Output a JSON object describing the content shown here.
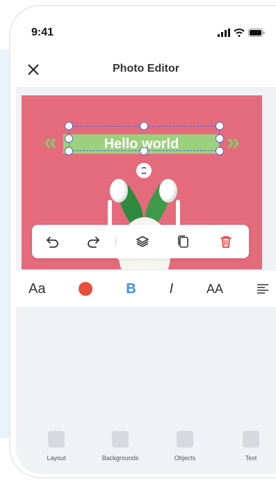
{
  "status_bar": {
    "time": "9:41"
  },
  "header": {
    "title": "Photo Editor"
  },
  "canvas": {
    "banner_text": "Hello world"
  },
  "floating_toolbar": {
    "icons": [
      "undo-icon",
      "redo-icon",
      "layers-icon",
      "copy-icon",
      "trash-icon"
    ],
    "delete_color": "#e53935"
  },
  "format_bar": {
    "font_label": "Aa",
    "color_value": "#e84c3d",
    "bold_label": "B",
    "italic_label": "I",
    "caps_label": "AA",
    "bold_active_color": "#3b8ef3"
  },
  "bottom_nav": {
    "items": [
      {
        "label": "Layout"
      },
      {
        "label": "Backgrounds"
      },
      {
        "label": "Objects"
      },
      {
        "label": "Text"
      }
    ]
  },
  "colors": {
    "canvas_bg": "#e46b7b",
    "banner": "#9bd17d",
    "selection": "#5a64d6"
  }
}
